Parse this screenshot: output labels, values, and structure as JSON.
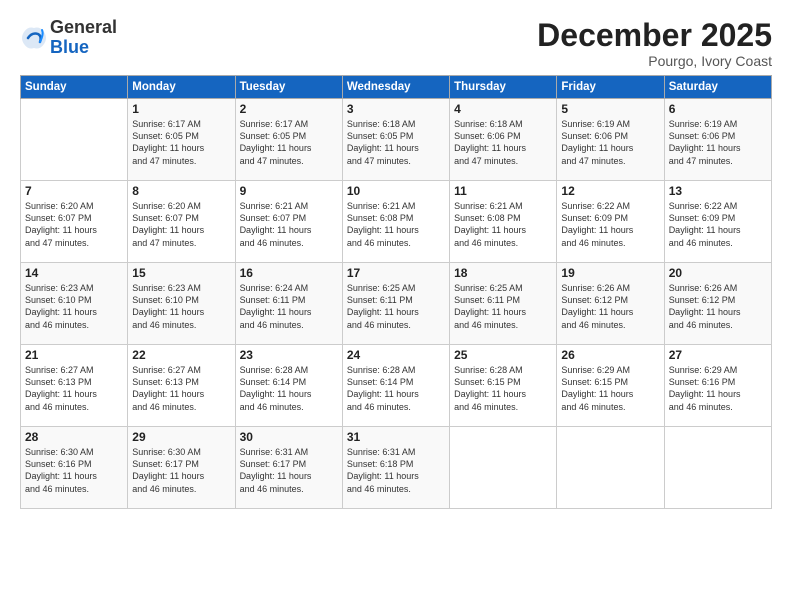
{
  "logo": {
    "general": "General",
    "blue": "Blue"
  },
  "title": "December 2025",
  "location": "Pourgo, Ivory Coast",
  "days_of_week": [
    "Sunday",
    "Monday",
    "Tuesday",
    "Wednesday",
    "Thursday",
    "Friday",
    "Saturday"
  ],
  "weeks": [
    [
      {
        "day": "",
        "info": ""
      },
      {
        "day": "1",
        "info": "Sunrise: 6:17 AM\nSunset: 6:05 PM\nDaylight: 11 hours\nand 47 minutes."
      },
      {
        "day": "2",
        "info": "Sunrise: 6:17 AM\nSunset: 6:05 PM\nDaylight: 11 hours\nand 47 minutes."
      },
      {
        "day": "3",
        "info": "Sunrise: 6:18 AM\nSunset: 6:05 PM\nDaylight: 11 hours\nand 47 minutes."
      },
      {
        "day": "4",
        "info": "Sunrise: 6:18 AM\nSunset: 6:06 PM\nDaylight: 11 hours\nand 47 minutes."
      },
      {
        "day": "5",
        "info": "Sunrise: 6:19 AM\nSunset: 6:06 PM\nDaylight: 11 hours\nand 47 minutes."
      },
      {
        "day": "6",
        "info": "Sunrise: 6:19 AM\nSunset: 6:06 PM\nDaylight: 11 hours\nand 47 minutes."
      }
    ],
    [
      {
        "day": "7",
        "info": "Sunrise: 6:20 AM\nSunset: 6:07 PM\nDaylight: 11 hours\nand 47 minutes."
      },
      {
        "day": "8",
        "info": "Sunrise: 6:20 AM\nSunset: 6:07 PM\nDaylight: 11 hours\nand 47 minutes."
      },
      {
        "day": "9",
        "info": "Sunrise: 6:21 AM\nSunset: 6:07 PM\nDaylight: 11 hours\nand 46 minutes."
      },
      {
        "day": "10",
        "info": "Sunrise: 6:21 AM\nSunset: 6:08 PM\nDaylight: 11 hours\nand 46 minutes."
      },
      {
        "day": "11",
        "info": "Sunrise: 6:21 AM\nSunset: 6:08 PM\nDaylight: 11 hours\nand 46 minutes."
      },
      {
        "day": "12",
        "info": "Sunrise: 6:22 AM\nSunset: 6:09 PM\nDaylight: 11 hours\nand 46 minutes."
      },
      {
        "day": "13",
        "info": "Sunrise: 6:22 AM\nSunset: 6:09 PM\nDaylight: 11 hours\nand 46 minutes."
      }
    ],
    [
      {
        "day": "14",
        "info": "Sunrise: 6:23 AM\nSunset: 6:10 PM\nDaylight: 11 hours\nand 46 minutes."
      },
      {
        "day": "15",
        "info": "Sunrise: 6:23 AM\nSunset: 6:10 PM\nDaylight: 11 hours\nand 46 minutes."
      },
      {
        "day": "16",
        "info": "Sunrise: 6:24 AM\nSunset: 6:11 PM\nDaylight: 11 hours\nand 46 minutes."
      },
      {
        "day": "17",
        "info": "Sunrise: 6:25 AM\nSunset: 6:11 PM\nDaylight: 11 hours\nand 46 minutes."
      },
      {
        "day": "18",
        "info": "Sunrise: 6:25 AM\nSunset: 6:11 PM\nDaylight: 11 hours\nand 46 minutes."
      },
      {
        "day": "19",
        "info": "Sunrise: 6:26 AM\nSunset: 6:12 PM\nDaylight: 11 hours\nand 46 minutes."
      },
      {
        "day": "20",
        "info": "Sunrise: 6:26 AM\nSunset: 6:12 PM\nDaylight: 11 hours\nand 46 minutes."
      }
    ],
    [
      {
        "day": "21",
        "info": "Sunrise: 6:27 AM\nSunset: 6:13 PM\nDaylight: 11 hours\nand 46 minutes."
      },
      {
        "day": "22",
        "info": "Sunrise: 6:27 AM\nSunset: 6:13 PM\nDaylight: 11 hours\nand 46 minutes."
      },
      {
        "day": "23",
        "info": "Sunrise: 6:28 AM\nSunset: 6:14 PM\nDaylight: 11 hours\nand 46 minutes."
      },
      {
        "day": "24",
        "info": "Sunrise: 6:28 AM\nSunset: 6:14 PM\nDaylight: 11 hours\nand 46 minutes."
      },
      {
        "day": "25",
        "info": "Sunrise: 6:28 AM\nSunset: 6:15 PM\nDaylight: 11 hours\nand 46 minutes."
      },
      {
        "day": "26",
        "info": "Sunrise: 6:29 AM\nSunset: 6:15 PM\nDaylight: 11 hours\nand 46 minutes."
      },
      {
        "day": "27",
        "info": "Sunrise: 6:29 AM\nSunset: 6:16 PM\nDaylight: 11 hours\nand 46 minutes."
      }
    ],
    [
      {
        "day": "28",
        "info": "Sunrise: 6:30 AM\nSunset: 6:16 PM\nDaylight: 11 hours\nand 46 minutes."
      },
      {
        "day": "29",
        "info": "Sunrise: 6:30 AM\nSunset: 6:17 PM\nDaylight: 11 hours\nand 46 minutes."
      },
      {
        "day": "30",
        "info": "Sunrise: 6:31 AM\nSunset: 6:17 PM\nDaylight: 11 hours\nand 46 minutes."
      },
      {
        "day": "31",
        "info": "Sunrise: 6:31 AM\nSunset: 6:18 PM\nDaylight: 11 hours\nand 46 minutes."
      },
      {
        "day": "",
        "info": ""
      },
      {
        "day": "",
        "info": ""
      },
      {
        "day": "",
        "info": ""
      }
    ]
  ]
}
